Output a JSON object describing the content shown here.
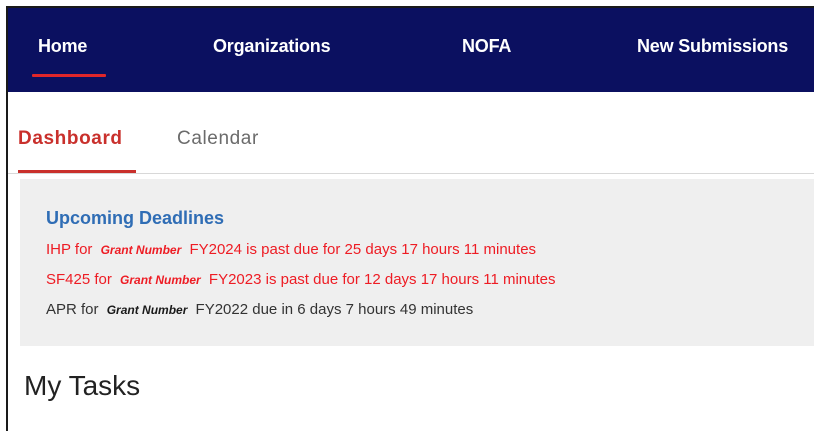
{
  "nav": {
    "items": [
      {
        "label": "Home"
      },
      {
        "label": "Organizations"
      },
      {
        "label": "NOFA"
      },
      {
        "label": "New Submissions"
      }
    ],
    "active": "Home",
    "colors": {
      "background": "#0b1060",
      "active_underline": "#e0262a"
    }
  },
  "tabs": {
    "items": [
      {
        "label": "Dashboard"
      },
      {
        "label": "Calendar"
      }
    ],
    "active": "Dashboard",
    "colors": {
      "active": "#c9302c",
      "inactive": "#6b6b6b"
    }
  },
  "deadlines": {
    "title": "Upcoming Deadlines",
    "colors": {
      "title": "#2f6db5",
      "overdue": "#ee1c24",
      "normal": "#333333"
    },
    "items": [
      {
        "prefix": "IHP for",
        "grant_label": "Grant Number",
        "suffix": "FY2024 is past due for 25 days 17 hours 11 minutes",
        "status": "overdue"
      },
      {
        "prefix": "SF425 for",
        "grant_label": "Grant Number",
        "suffix": "FY2023 is past due for 12 days 17 hours 11 minutes",
        "status": "overdue"
      },
      {
        "prefix": "APR for",
        "grant_label": "Grant Number",
        "suffix": "FY2022 due in 6 days 7 hours 49 minutes",
        "status": "upcoming"
      }
    ]
  },
  "main": {
    "tasks_title": "My Tasks"
  }
}
